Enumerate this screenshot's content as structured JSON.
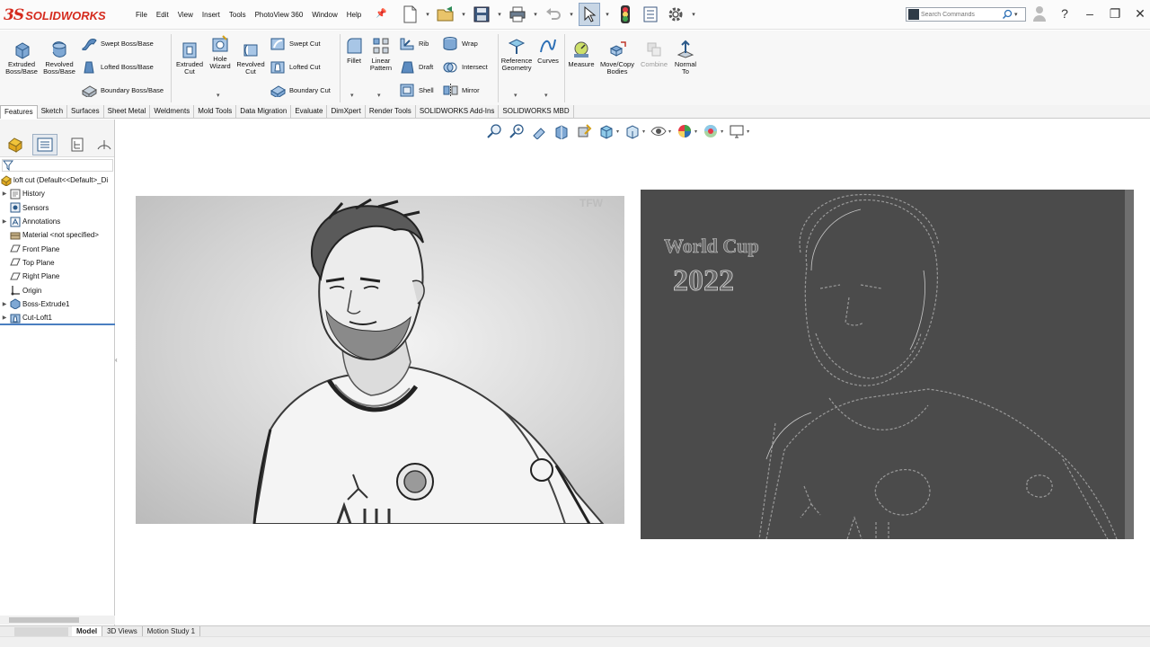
{
  "app": {
    "brand_ds": "3S",
    "brand_name": "SOLIDWORKS"
  },
  "menu": [
    "File",
    "Edit",
    "View",
    "Insert",
    "Tools",
    "PhotoView 360",
    "Window",
    "Help"
  ],
  "search": {
    "placeholder": "Search Commands"
  },
  "ribbon": {
    "extruded_boss": "Extruded Boss/Base",
    "revolved_boss": "Revolved Boss/Base",
    "swept_boss": "Swept Boss/Base",
    "lofted_boss": "Lofted Boss/Base",
    "boundary_boss": "Boundary Boss/Base",
    "extruded_cut": "Extruded Cut",
    "hole_wizard": "Hole Wizard",
    "revolved_cut": "Revolved Cut",
    "swept_cut": "Swept Cut",
    "lofted_cut": "Lofted Cut",
    "boundary_cut": "Boundary Cut",
    "fillet": "Fillet",
    "linear_pattern": "Linear Pattern",
    "rib": "Rib",
    "draft": "Draft",
    "shell": "Shell",
    "wrap": "Wrap",
    "intersect": "Intersect",
    "mirror": "Mirror",
    "reference_geometry": "Reference Geometry",
    "curves": "Curves",
    "measure": "Measure",
    "move_copy_bodies": "Move/Copy Bodies",
    "combine": "Combine",
    "normal_to": "Normal To"
  },
  "cm_tabs": [
    "Features",
    "Sketch",
    "Surfaces",
    "Sheet Metal",
    "Weldments",
    "Mold Tools",
    "Data Migration",
    "Evaluate",
    "DimXpert",
    "Render Tools",
    "SOLIDWORKS Add-Ins",
    "SOLIDWORKS MBD"
  ],
  "tree": {
    "root": "loft cut  (Default<<Default>_Di",
    "items": [
      "History",
      "Sensors",
      "Annotations",
      "Material <not specified>",
      "Front Plane",
      "Top Plane",
      "Right Plane",
      "Origin",
      "Boss-Extrude1",
      "Cut-Loft1"
    ]
  },
  "images": {
    "left_watermark": "TFW",
    "right_line1": "World Cup",
    "right_line2": "2022"
  },
  "bottom_tabs": [
    "Model",
    "3D Views",
    "Motion Study 1"
  ],
  "colors": {
    "brand": "#d52b1e",
    "accent": "#4a7fc1",
    "relief_bg": "#4b4b4b"
  }
}
